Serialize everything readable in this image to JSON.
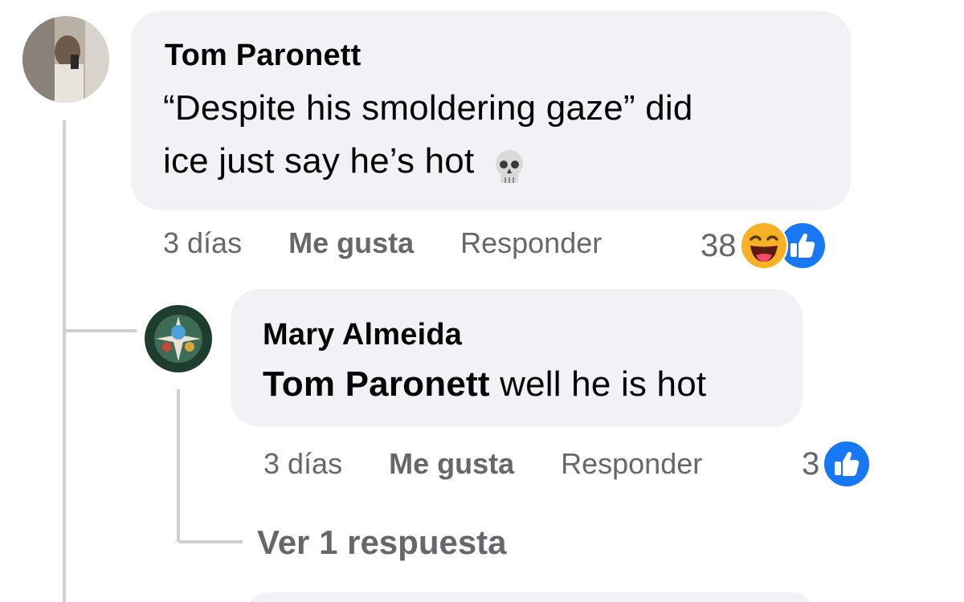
{
  "comment": {
    "author": "Tom Paronett",
    "text_line1": "“Despite his smoldering gaze” did",
    "text_line2": "ice just say he’s hot",
    "text_emoji": "skull-emoji",
    "time": "3 días",
    "like_label": "Me gusta",
    "reply_label": "Responder",
    "reaction_count": "38",
    "reaction_icons": [
      "laughing-emoji",
      "like-thumbs-up"
    ]
  },
  "reply": {
    "author": "Mary Almeida",
    "mention": "Tom Paronett",
    "text": "well he is hot",
    "time": "3 días",
    "like_label": "Me gusta",
    "reply_label": "Responder",
    "reaction_count": "3",
    "reaction_icons": [
      "like-thumbs-up"
    ],
    "see_replies_label": "Ver 1 respuesta"
  },
  "colors": {
    "bubble": "#f0f2f5",
    "secondary_text": "#65676b",
    "like_blue": "#1877f2",
    "thread_line": "#ced0d4"
  }
}
